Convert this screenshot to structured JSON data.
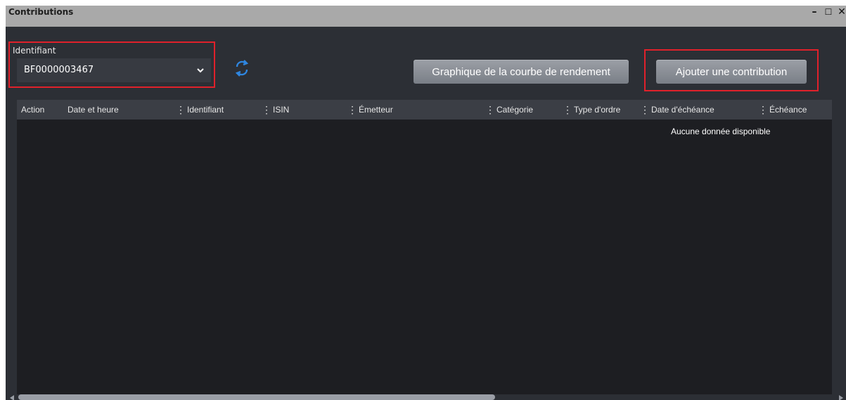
{
  "window": {
    "title": "Contributions",
    "controls": {
      "minimize": "–",
      "maximize": "☐",
      "close": "✕"
    }
  },
  "identifiant": {
    "label": "Identifiant",
    "value": "BF0000003467",
    "caret_icon": "chevron-down-icon"
  },
  "refresh_icon": "refresh-icon",
  "buttons": {
    "chart": "Graphique de la courbe de rendement",
    "add": "Ajouter une contribution"
  },
  "grid": {
    "columns": [
      {
        "label": "Action"
      },
      {
        "label": "Date et heure"
      },
      {
        "label": "Identifiant"
      },
      {
        "label": "ISIN"
      },
      {
        "label": "Émetteur"
      },
      {
        "label": "Catégorie"
      },
      {
        "label": "Type d'ordre"
      },
      {
        "label": "Date d'échéance"
      },
      {
        "label": "Échéance"
      }
    ],
    "empty_message": "Aucune donnée disponible"
  },
  "colors": {
    "accent_red": "#e0212b",
    "refresh_blue": "#2f86e0",
    "panel_bg": "#2c2f35",
    "grid_bg": "#1d1e22",
    "header_bg": "#3b3e45"
  }
}
